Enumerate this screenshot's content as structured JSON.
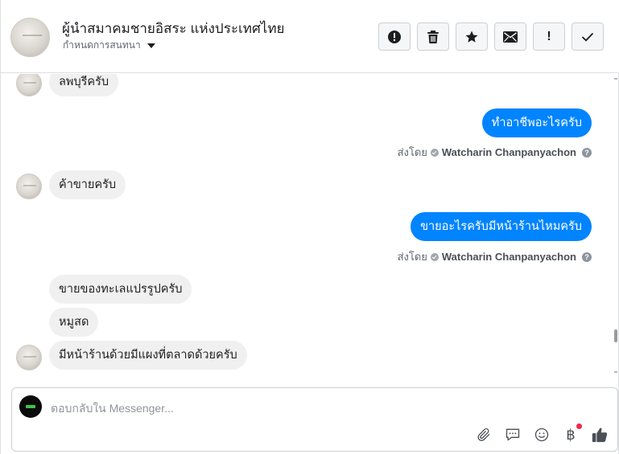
{
  "header": {
    "title": "ผู้นำสมาคมชายอิสระ แห่งประเทศไทย",
    "subtitle": "กำหนดการสนทนา",
    "actions": [
      {
        "name": "report-button",
        "icon": "alert-circle-icon",
        "label": ""
      },
      {
        "name": "delete-button",
        "icon": "trash-icon",
        "label": ""
      },
      {
        "name": "star-button",
        "icon": "star-icon",
        "label": ""
      },
      {
        "name": "mark-unread-button",
        "icon": "envelope-icon",
        "label": ""
      },
      {
        "name": "important-button",
        "icon": "exclamation-icon",
        "label": "!"
      },
      {
        "name": "done-button",
        "icon": "check-icon",
        "label": ""
      }
    ]
  },
  "messages": [
    {
      "side": "in",
      "text": "ลพบุรีครับ"
    },
    {
      "side": "out",
      "text": "ทำอาชีพอะไรครับ"
    },
    {
      "sent_by_label": "ส่งโดย",
      "sender": "Watcharin Chanpanyachon"
    },
    {
      "side": "in",
      "text": "ค้าขายครับ"
    },
    {
      "side": "out",
      "text": "ขายอะไรครับมีหน้าร้านไหมครับ"
    },
    {
      "sent_by_label": "ส่งโดย",
      "sender": "Watcharin Chanpanyachon"
    },
    {
      "side": "in",
      "text": "ขายของทะเลแปรรูปครับ"
    },
    {
      "side": "in",
      "text": "หมูสด"
    },
    {
      "side": "in",
      "text": "มีหน้าร้านด้วยมีแผงที่ตลาดด้วยครับ"
    }
  ],
  "composer": {
    "placeholder": "ตอบกลับใน Messenger...",
    "tools": [
      "paperclip-icon",
      "chat-bubble-icon",
      "smiley-icon",
      "baht-icon",
      "thumbs-up-icon"
    ],
    "baht_symbol": "฿"
  },
  "colors": {
    "outgoing_bubble": "#0084ff",
    "incoming_bubble": "#f1f0f0",
    "badge": "#f02849"
  }
}
